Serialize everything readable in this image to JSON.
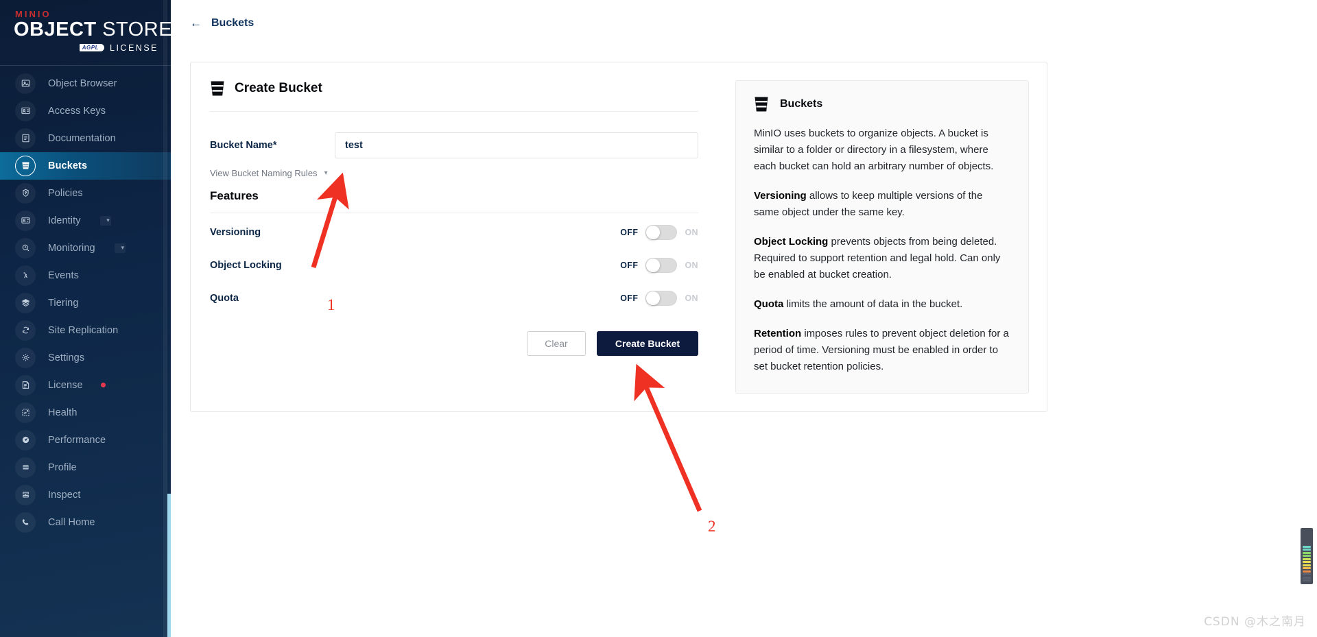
{
  "brand": {
    "minio": "MINIO",
    "object": "OBJECT",
    "store": "STORE",
    "agpl": "AGPL",
    "license": "LICENSE"
  },
  "sidebar": {
    "items": [
      {
        "label": "Object Browser",
        "icon": "image-browser-icon",
        "active": false,
        "chevron": false,
        "badge": false
      },
      {
        "label": "Access Keys",
        "icon": "id-card-icon",
        "active": false,
        "chevron": false,
        "badge": false
      },
      {
        "label": "Documentation",
        "icon": "book-icon",
        "active": false,
        "chevron": false,
        "badge": false
      },
      {
        "label": "Buckets",
        "icon": "bucket-icon",
        "active": true,
        "chevron": false,
        "badge": false
      },
      {
        "label": "Policies",
        "icon": "shield-lock-icon",
        "active": false,
        "chevron": false,
        "badge": false
      },
      {
        "label": "Identity",
        "icon": "identity-card-icon",
        "active": false,
        "chevron": true,
        "badge": false
      },
      {
        "label": "Monitoring",
        "icon": "magnifier-icon",
        "active": false,
        "chevron": true,
        "badge": false
      },
      {
        "label": "Events",
        "icon": "lambda-icon",
        "active": false,
        "chevron": false,
        "badge": false
      },
      {
        "label": "Tiering",
        "icon": "layers-icon",
        "active": false,
        "chevron": false,
        "badge": false
      },
      {
        "label": "Site Replication",
        "icon": "sync-icon",
        "active": false,
        "chevron": false,
        "badge": false
      },
      {
        "label": "Settings",
        "icon": "gear-icon",
        "active": false,
        "chevron": false,
        "badge": false
      },
      {
        "label": "License",
        "icon": "certificate-icon",
        "active": false,
        "chevron": false,
        "badge": true
      },
      {
        "label": "Health",
        "icon": "diagnostics-icon",
        "active": false,
        "chevron": false,
        "badge": false
      },
      {
        "label": "Performance",
        "icon": "gauge-icon",
        "active": false,
        "chevron": false,
        "badge": false
      },
      {
        "label": "Profile",
        "icon": "profile-icon",
        "active": false,
        "chevron": false,
        "badge": false
      },
      {
        "label": "Inspect",
        "icon": "inspect-icon",
        "active": false,
        "chevron": false,
        "badge": false
      },
      {
        "label": "Call Home",
        "icon": "phone-icon",
        "active": false,
        "chevron": false,
        "badge": false
      }
    ]
  },
  "topbar": {
    "back_label": "Buckets",
    "back_arrow": "←"
  },
  "form": {
    "title": "Create Bucket",
    "bucket_name_label": "Bucket Name*",
    "bucket_name_value": "test",
    "bucket_name_placeholder": "",
    "naming_rules_label": "View Bucket Naming Rules",
    "features_title": "Features",
    "features": [
      {
        "label": "Versioning",
        "off_label": "OFF",
        "on_label": "ON",
        "state": "off"
      },
      {
        "label": "Object Locking",
        "off_label": "OFF",
        "on_label": "ON",
        "state": "off"
      },
      {
        "label": "Quota",
        "off_label": "OFF",
        "on_label": "ON",
        "state": "off"
      }
    ],
    "clear_label": "Clear",
    "create_label": "Create Bucket"
  },
  "info": {
    "title": "Buckets",
    "paragraphs": [
      {
        "lead": "",
        "text": "MinIO uses buckets to organize objects. A bucket is similar to a folder or directory in a filesystem, where each bucket can hold an arbitrary number of objects."
      },
      {
        "lead": "Versioning",
        "text": " allows to keep multiple versions of the same object under the same key."
      },
      {
        "lead": "Object Locking",
        "text": " prevents objects from being deleted. Required to support retention and legal hold. Can only be enabled at bucket creation."
      },
      {
        "lead": "Quota",
        "text": " limits the amount of data in the bucket."
      },
      {
        "lead": "Retention",
        "text": " imposes rules to prevent object deletion for a period of time. Versioning must be enabled in order to set bucket retention policies."
      }
    ]
  },
  "annotations": {
    "marker_one": "1",
    "marker_two": "2",
    "arrow_color": "#ef3124"
  },
  "watermark": "CSDN @木之南月"
}
